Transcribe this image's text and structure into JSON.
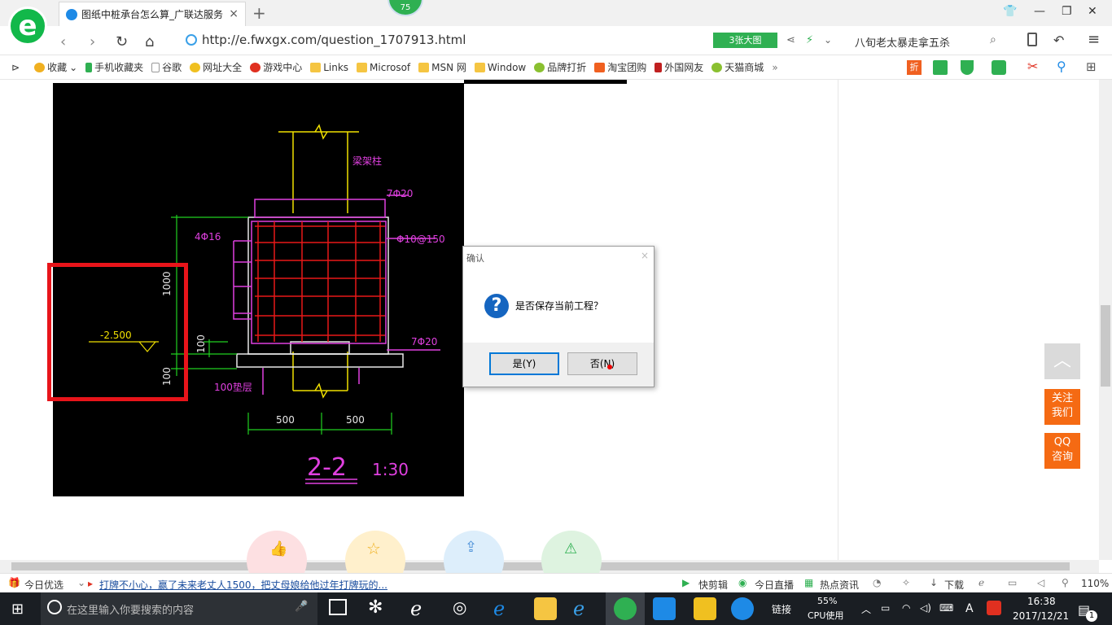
{
  "browser": {
    "tab_title": "图纸中桩承台怎么算_广联达服务",
    "tab_close": "×",
    "new_tab": "+",
    "badge_count": "75",
    "url": "http://e.fwxgx.com/question_1707913.html",
    "big_image_label": "3张大图",
    "search_text": "八旬老太暴走拿五杀"
  },
  "bookmarks": [
    {
      "label": "收藏",
      "color": "#f0b020"
    },
    {
      "label": "手机收藏夹",
      "color": "#2fb052"
    },
    {
      "label": "谷歌",
      "color": "#ffffff"
    },
    {
      "label": "网址大全",
      "color": "#f0c020"
    },
    {
      "label": "游戏中心",
      "color": "#e03020"
    },
    {
      "label": "Links",
      "color": "#f5c542"
    },
    {
      "label": "Microsof",
      "color": "#f5c542"
    },
    {
      "label": "MSN 网",
      "color": "#f5c542"
    },
    {
      "label": "Window",
      "color": "#f5c542"
    },
    {
      "label": "品牌打折",
      "color": "#8ac030"
    },
    {
      "label": "淘宝团购",
      "color": "#f06020"
    },
    {
      "label": "外国网友",
      "color": "#c02020"
    },
    {
      "label": "天猫商城",
      "color": "#8ac030"
    }
  ],
  "bookmarks_more": "»",
  "cad": {
    "labels": [
      "梁架柱",
      "7Φ20",
      "4Φ16",
      "Φ10@150",
      "1000",
      "-2.500",
      "100",
      "7Φ20",
      "100",
      "100垫层",
      "500",
      "500",
      "2-2",
      "1:30"
    ]
  },
  "dialog": {
    "title": "确认",
    "close": "×",
    "icon_glyph": "?",
    "message": "是否保存当前工程？",
    "yes_label": "是(Y)",
    "no_label": "否(N)"
  },
  "side": {
    "follow_label": "关注\n我们",
    "qq_label": "QQ\n咨询"
  },
  "status": {
    "daily": "今日优选",
    "headline": "打牌不小心，赢了未来老丈人1500，把丈母娘给他过年打牌玩的...",
    "items": [
      "快剪辑",
      "今日直播",
      "热点资讯"
    ],
    "download": "下载",
    "zoom": "110%"
  },
  "taskbar": {
    "search_placeholder": "在这里输入你要搜索的内容",
    "link_label": "链接",
    "cpu_percent": "55%",
    "cpu_label": "CPU使用",
    "time": "16:38",
    "date": "2017/12/21",
    "ime": "A",
    "notif_count": "1"
  }
}
